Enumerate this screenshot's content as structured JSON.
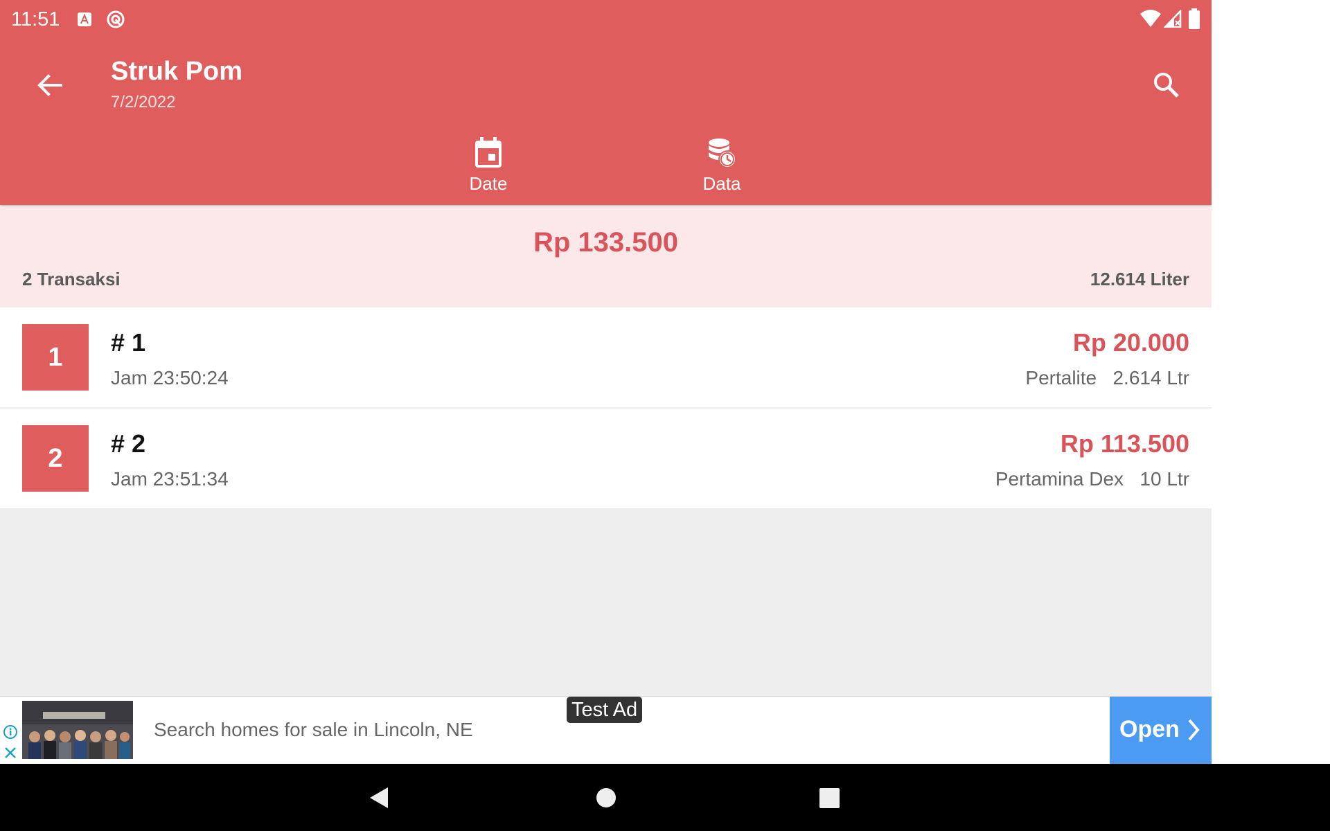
{
  "status_bar": {
    "time": "11:51"
  },
  "app_bar": {
    "title": "Struk Pom",
    "subtitle": "7/2/2022"
  },
  "tabs": [
    {
      "label": "Date"
    },
    {
      "label": "Data"
    }
  ],
  "summary": {
    "total": "Rp 133.500",
    "count": "2 Transaksi",
    "liters": "12.614 Liter"
  },
  "transactions": [
    {
      "index": "1",
      "number": "# 1",
      "time": "Jam 23:50:24",
      "amount": "Rp 20.000",
      "fuel": "Pertalite",
      "volume": "2.614 Ltr"
    },
    {
      "index": "2",
      "number": "# 2",
      "time": "Jam 23:51:34",
      "amount": "Rp 113.500",
      "fuel": "Pertamina Dex",
      "volume": "10 Ltr"
    }
  ],
  "ad": {
    "label": "Test Ad",
    "text": "Search homes for sale in Lincoln, NE",
    "button": "Open"
  },
  "colors": {
    "primary": "#df5d5d",
    "accent_text": "#d9545a",
    "summary_bg": "#fde8e9",
    "ad_button": "#4b9bf3"
  },
  "icons": [
    "back-arrow-icon",
    "search-icon",
    "calendar-icon",
    "database-clock-icon",
    "info-icon",
    "close-icon",
    "chevron-right-icon",
    "wifi-icon",
    "signal-icon",
    "battery-icon"
  ]
}
